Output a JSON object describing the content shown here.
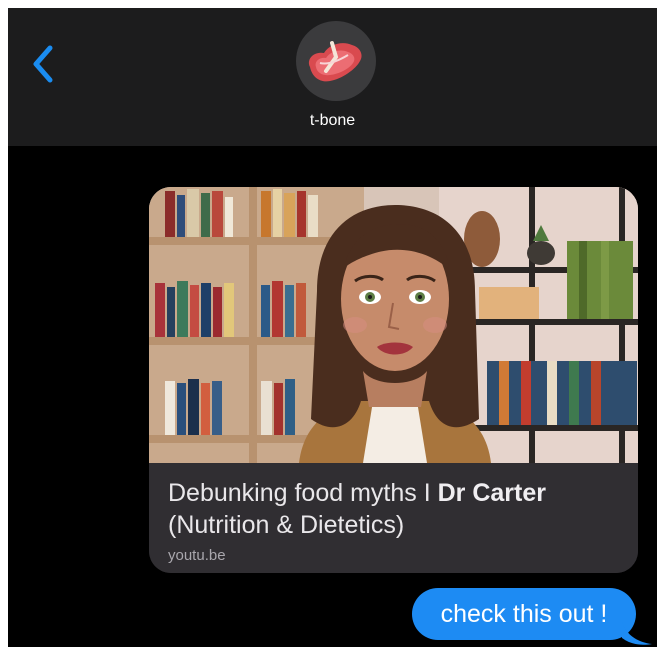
{
  "header": {
    "contact_name": "t-bone",
    "back_icon": "chevron-left-icon",
    "avatar_icon": "tbone-steak-icon"
  },
  "messages": {
    "link_preview": {
      "title_part1": "Debunking food myths I ",
      "title_part2": "Dr Carter",
      "title_line2": "(Nutrition & Dietetics)",
      "domain": "youtu.be"
    },
    "sent": {
      "text": "check this out !"
    }
  },
  "colors": {
    "accent": "#1d8bf3",
    "header_bg": "#1c1c1d",
    "background": "#000000"
  }
}
